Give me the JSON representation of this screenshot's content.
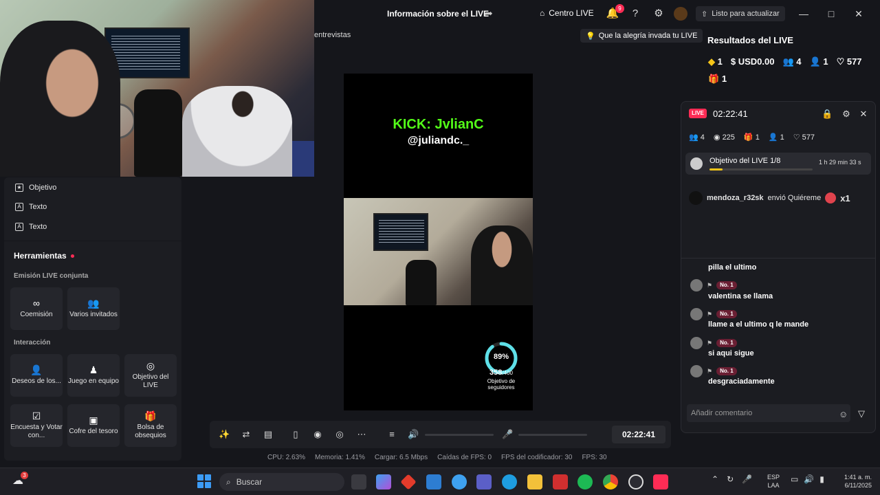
{
  "titlebar": {
    "live_info": "Información sobre el LIVE",
    "centro_live": "Centro LIVE",
    "notif_count": "9",
    "update": "Listo para actualizar"
  },
  "camera": {
    "entrevistas": "entrevistas"
  },
  "banner": "Que la alegría invada tu LIVE",
  "left_panel": {
    "items": [
      "Objetivo",
      "Texto",
      "Texto"
    ],
    "tools_header": "Herramientas",
    "section_conjunta": "Emisión LIVE conjunta",
    "conjunta_tools": [
      "Coemisión",
      "Varios invitados"
    ],
    "section_interaccion": "Interacción",
    "interaccion_tools": [
      "Deseos de los...",
      "Juego en equipo",
      "Objetivo del LIVE",
      "Encuesta y Votar con...",
      "Cofre del tesoro",
      "Bolsa de obsequios"
    ]
  },
  "stream": {
    "kick": "KICK: JvlianC",
    "handle": "@juliandc._",
    "goal_pct": "89%",
    "goal_count": "358",
    "goal_total": "/400",
    "goal_label": "Objetivo de seguidores",
    "goal_fraction": 0.895
  },
  "controls": {
    "timer": "02:22:41"
  },
  "stats": {
    "cpu": "CPU: 2.63%",
    "memoria": "Memoria: 1.41%",
    "cargar": "Cargar: 6.5 Mbps",
    "caidas": "Caídas de FPS: 0",
    "fps_cod": "FPS del codificador: 30",
    "fps": "FPS: 30"
  },
  "results": {
    "title": "Resultados del LIVE",
    "diamonds": "1",
    "usd": "USD0.00",
    "viewers": "4",
    "new_followers": "1",
    "likes": "577",
    "gifts": "1"
  },
  "float": {
    "live": "LIVE",
    "timer": "02:22:41",
    "viewers": "4",
    "views": "225",
    "gifts": "1",
    "followers": "1",
    "likes": "577",
    "goal_title": "Objetivo del LIVE",
    "goal_progress": "1/8",
    "goal_time": "1 h 29 min 33 s",
    "gift_user": "mendoza_r32sk",
    "gift_text": "envió Quiéreme",
    "gift_count": "x1",
    "chat": [
      {
        "badge": "",
        "text": "pilla el ultimo"
      },
      {
        "badge": "No. 1",
        "text": "valentina se llama"
      },
      {
        "badge": "No. 1",
        "text": "llame a el ultimo q le mande"
      },
      {
        "badge": "No. 1",
        "text": "si aqui sigue"
      },
      {
        "badge": "No. 1",
        "text": "desgraciadamente"
      }
    ],
    "comment_placeholder": "Añadir comentario"
  },
  "taskbar": {
    "weather_badge": "3",
    "search": "Buscar",
    "lang1": "ESP",
    "lang2": "LAA",
    "time": "1:41 a. m.",
    "date": "6/11/2025"
  }
}
